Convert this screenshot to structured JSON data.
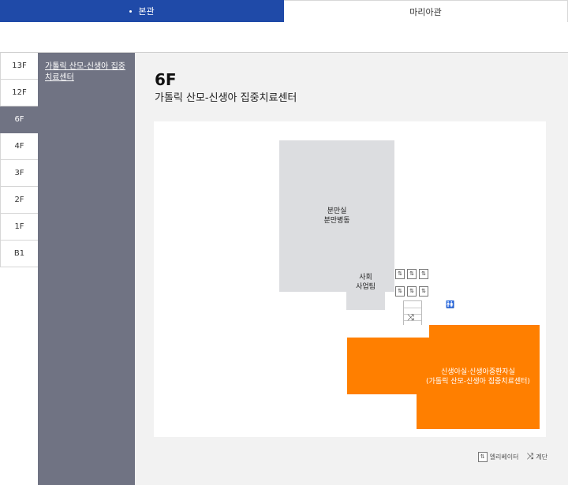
{
  "tabs": {
    "main": "본관",
    "other": "마리아관"
  },
  "floors": [
    "13F",
    "12F",
    "6F",
    "4F",
    "3F",
    "2F",
    "1F",
    "B1"
  ],
  "active_floor": "6F",
  "submenu": {
    "link": "가톨릭 산모-신생아 집중치료센터"
  },
  "content": {
    "floor": "6F",
    "subtitle": "가톨릭 산모-신생아 집중치료센터"
  },
  "map": {
    "room_delivery_line1": "분만실",
    "room_delivery_line2": "분만병동",
    "room_social_line1": "사회",
    "room_social_line2": "사업팀",
    "room_nicu_line1": "신생아실·신생아중환자실",
    "room_nicu_line2": "(가톨릭 산모-신생아 집중치료센터)",
    "elevator_glyph": "⇅",
    "stairs_glyph": "⤨",
    "restroom_glyph": "🚻"
  },
  "legend": {
    "elevator": "엘리베이터",
    "stairs": "계단"
  },
  "colors": {
    "tab_active": "#1f4aa8",
    "sidebar": "#707383",
    "highlight_room": "#ff7f00",
    "room": "#dcdde0"
  }
}
